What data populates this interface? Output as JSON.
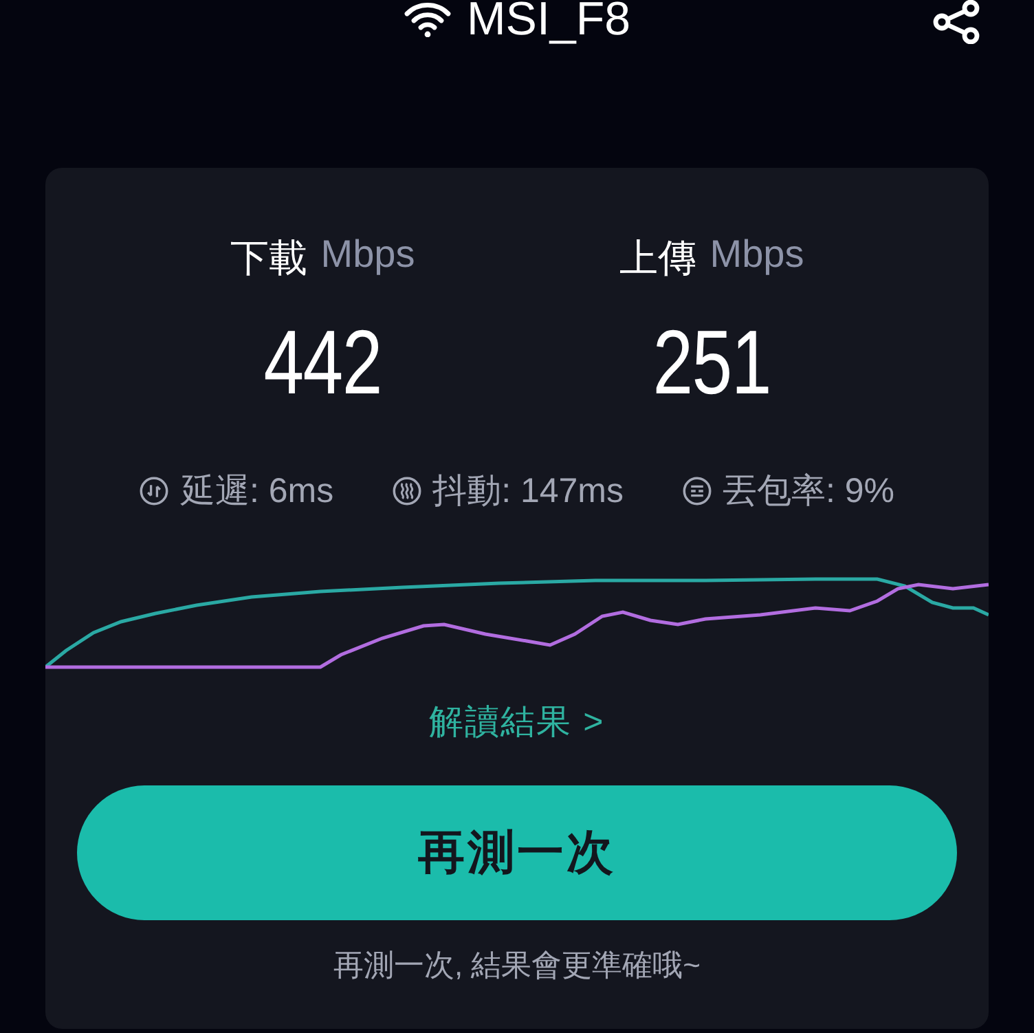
{
  "header": {
    "network": "MSI_F8"
  },
  "metrics": [
    {
      "label": "下載",
      "unit": "Mbps",
      "value": "442"
    },
    {
      "label": "上傳",
      "unit": "Mbps",
      "value": "251"
    }
  ],
  "stats": [
    {
      "kind": "latency",
      "text": "延遲: 6ms"
    },
    {
      "kind": "jitter",
      "text": "抖動: 147ms"
    },
    {
      "kind": "loss",
      "text": "丟包率: 9%"
    }
  ],
  "link": {
    "label": "解讀結果",
    "arrow": ">"
  },
  "button": {
    "label": "再測一次"
  },
  "footnote": "再測一次, 結果會更準確哦~"
}
